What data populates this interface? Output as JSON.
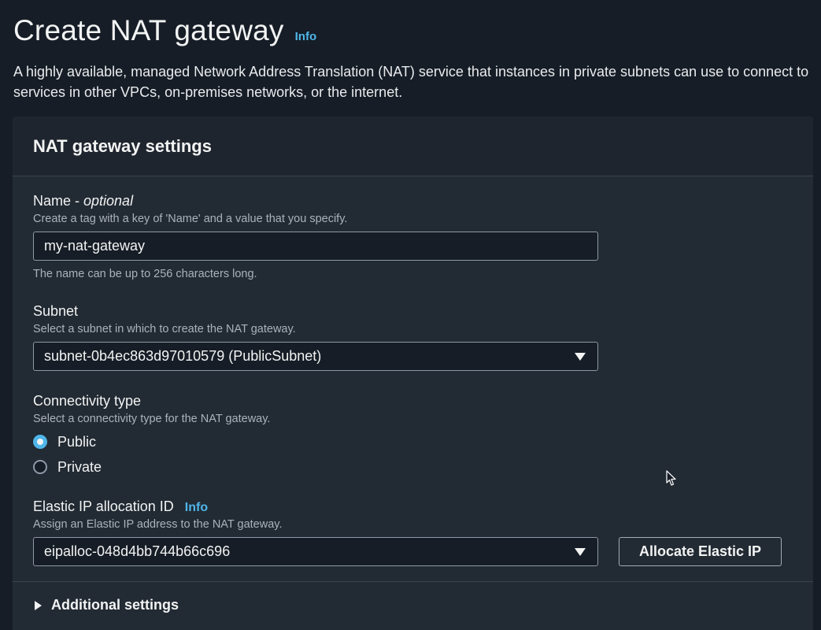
{
  "header": {
    "title": "Create NAT gateway",
    "info_label": "Info",
    "description": "A highly available, managed Network Address Translation (NAT) service that instances in private subnets can use to connect to services in other VPCs, on-premises networks, or the internet."
  },
  "panel": {
    "title": "NAT gateway settings"
  },
  "name_field": {
    "label": "Name - ",
    "label_optional": "optional",
    "description": "Create a tag with a key of 'Name' and a value that you specify.",
    "value": "my-nat-gateway",
    "hint": "The name can be up to 256 characters long."
  },
  "subnet_field": {
    "label": "Subnet",
    "description": "Select a subnet in which to create the NAT gateway.",
    "selected": "subnet-0b4ec863d97010579 (PublicSubnet)"
  },
  "connectivity_field": {
    "label": "Connectivity type",
    "description": "Select a connectivity type for the NAT gateway.",
    "options": [
      {
        "label": "Public",
        "checked": true
      },
      {
        "label": "Private",
        "checked": false
      }
    ]
  },
  "eip_field": {
    "label": "Elastic IP allocation ID",
    "info_label": "Info",
    "description": "Assign an Elastic IP address to the NAT gateway.",
    "selected": "eipalloc-048d4bb744b66c696",
    "allocate_button": "Allocate Elastic IP"
  },
  "additional_settings": {
    "label": "Additional settings"
  },
  "colors": {
    "background": "#161d26",
    "panel": "#222a33",
    "accent": "#4fb6ea",
    "text": "#f2f3f3",
    "muted": "#aab2bb"
  }
}
